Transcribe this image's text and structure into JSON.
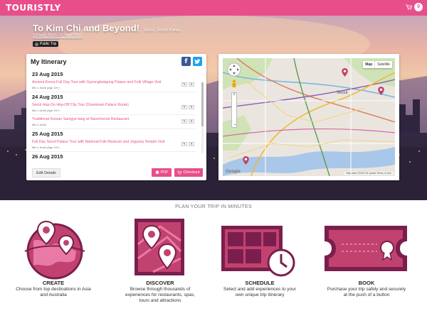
{
  "nav": {
    "logo": "TOURISTLY",
    "cart_count": "0"
  },
  "hero": {
    "title": "To Kim Chi and Beyond!",
    "subtitle": "Seoul, South Korea",
    "dates": "23 Aug 2015 - 1 Sep 2015",
    "badge": "Public Trip"
  },
  "itinerary": {
    "heading": "My Itinerary",
    "days": [
      {
        "date": "23 Aug 2015",
        "items": [
          {
            "title": "Ancient Korea Full Day Tour with Gyeongbokgung Palace and Folk Village Visit",
            "meta": "Min 1 Adult (Age 15+)"
          }
        ]
      },
      {
        "date": "24 Aug 2015",
        "items": [
          {
            "title": "Seoul Hop-On Hop-Off City Tour (Downtown Palace Route)",
            "meta": "Min 1 Adult (Age 15+)"
          },
          {
            "title": "Traditional Korean Samgye-tang at Namchonok Restaurant",
            "meta": "Min 1 Adult"
          }
        ]
      },
      {
        "date": "25 Aug 2015",
        "items": [
          {
            "title": "Full Day Seoul Palace Tour with National Folk Museum and Jogyesa Temple Visit",
            "meta": "Min 1 Adult (Age 15+)"
          }
        ]
      }
    ],
    "next_day": "26 Aug 2015",
    "edit_label": "Edit Details",
    "pdf_label": "PDF",
    "checkout_label": "Checkout"
  },
  "map": {
    "map_tab": "Map",
    "satellite_tab": "Satellite",
    "city_label": "Seoul",
    "copyright": "Map data ©2015 SK planet   Terms of Use",
    "google": "Google"
  },
  "howto": {
    "title": "PLAN YOUR TRIP IN MINUTES",
    "steps": [
      {
        "title": "CREATE",
        "desc1": "Choose from top destinations in Asia",
        "desc2": "and Australia"
      },
      {
        "title": "DISCOVER",
        "desc1": "Browse through thousands of",
        "desc2": "experiences for restaurants, spas,",
        "desc3": "tours and attractions"
      },
      {
        "title": "SCHEDULE",
        "desc1": "Select and add experiences to your",
        "desc2": "own unique trip itinerary"
      },
      {
        "title": "BOOK",
        "desc1": "Purchase your trip safely and securely",
        "desc2": "at the push of a button"
      }
    ]
  },
  "colors": {
    "accent": "#e84e8a",
    "dark_accent": "#7a1f4d"
  }
}
